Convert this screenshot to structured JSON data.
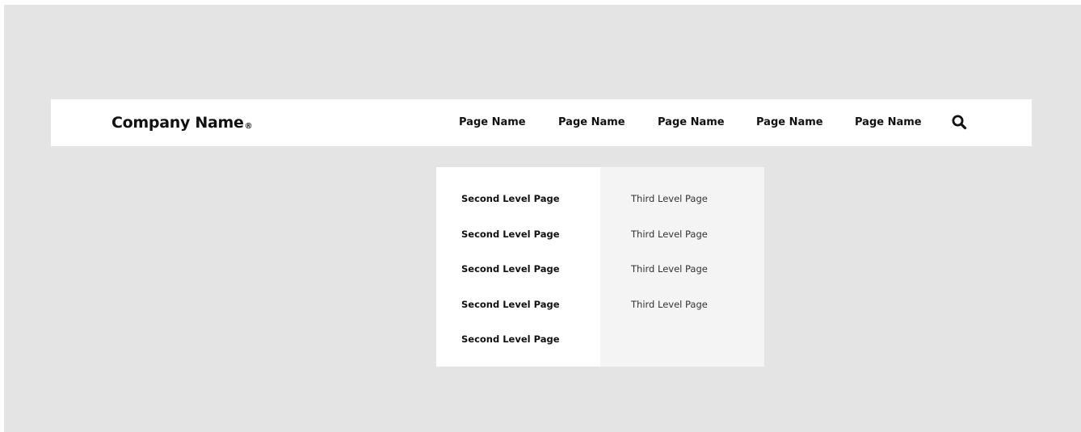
{
  "header": {
    "brand": "Company Name",
    "brand_mark": "®",
    "nav_items": [
      {
        "label": "Page Name"
      },
      {
        "label": "Page Name"
      },
      {
        "label": "Page Name"
      },
      {
        "label": "Page Name"
      },
      {
        "label": "Page Name"
      }
    ],
    "search_icon": "search-icon"
  },
  "dropdown": {
    "second_level": [
      {
        "label": "Second Level Page"
      },
      {
        "label": "Second Level Page"
      },
      {
        "label": "Second Level Page"
      },
      {
        "label": "Second Level Page"
      },
      {
        "label": "Second Level Page"
      }
    ],
    "third_level": [
      {
        "label": "Third Level Page"
      },
      {
        "label": "Third Level Page"
      },
      {
        "label": "Third Level Page"
      },
      {
        "label": "Third Level Page"
      }
    ]
  },
  "colors": {
    "background": "#e4e4e4",
    "navbar": "#ffffff",
    "second_level_panel": "#ffffff",
    "third_level_panel": "#f4f4f4",
    "text": "#111111"
  }
}
